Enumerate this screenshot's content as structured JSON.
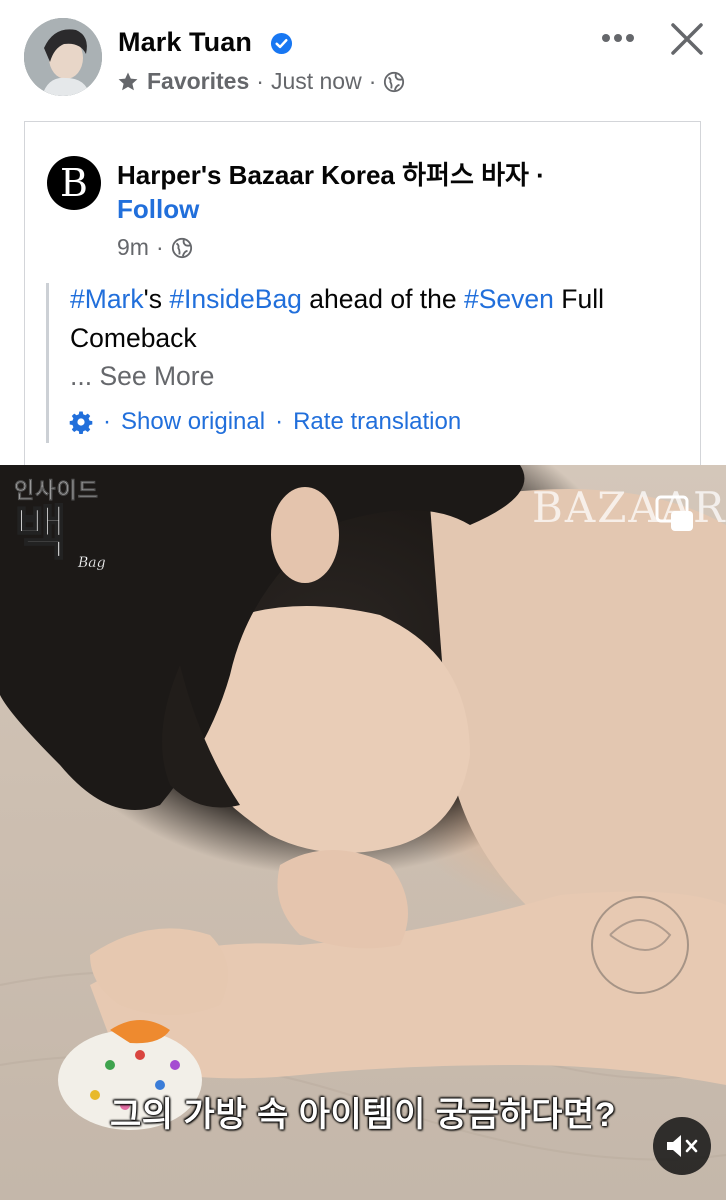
{
  "post": {
    "author": "Mark Tuan",
    "audience_label": "Favorites",
    "time": "Just now",
    "sep": "·"
  },
  "shared": {
    "page_logo_letter": "B",
    "page_name": "Harper's Bazaar Korea 하퍼스 바자 ·",
    "follow": "Follow",
    "time": "9m",
    "sep": "·",
    "caption": {
      "tag1": "#Mark",
      "text1": "'s ",
      "tag2": "#InsideBag",
      "text2": " ahead of the ",
      "tag3": "#Seven",
      "text3": " Full Comeback"
    },
    "see_more": "... See More",
    "translation": {
      "show_original": "Show original",
      "rate": "Rate translation",
      "sep": "·"
    }
  },
  "video": {
    "logo_small": "인사이드",
    "logo_big": "백",
    "logo_sub": "Bag",
    "watermark": "BAZAAR",
    "subtitle": "그의 가방 속 아이템이 궁금하다면?"
  },
  "colors": {
    "link_blue": "#216fdb",
    "secondary_text": "#65676b",
    "verified_blue": "#1877f2"
  },
  "icons": [
    "verified-icon",
    "star-icon",
    "globe-icon",
    "more-icon",
    "close-icon",
    "gear-icon",
    "pip-icon",
    "mute-icon"
  ]
}
